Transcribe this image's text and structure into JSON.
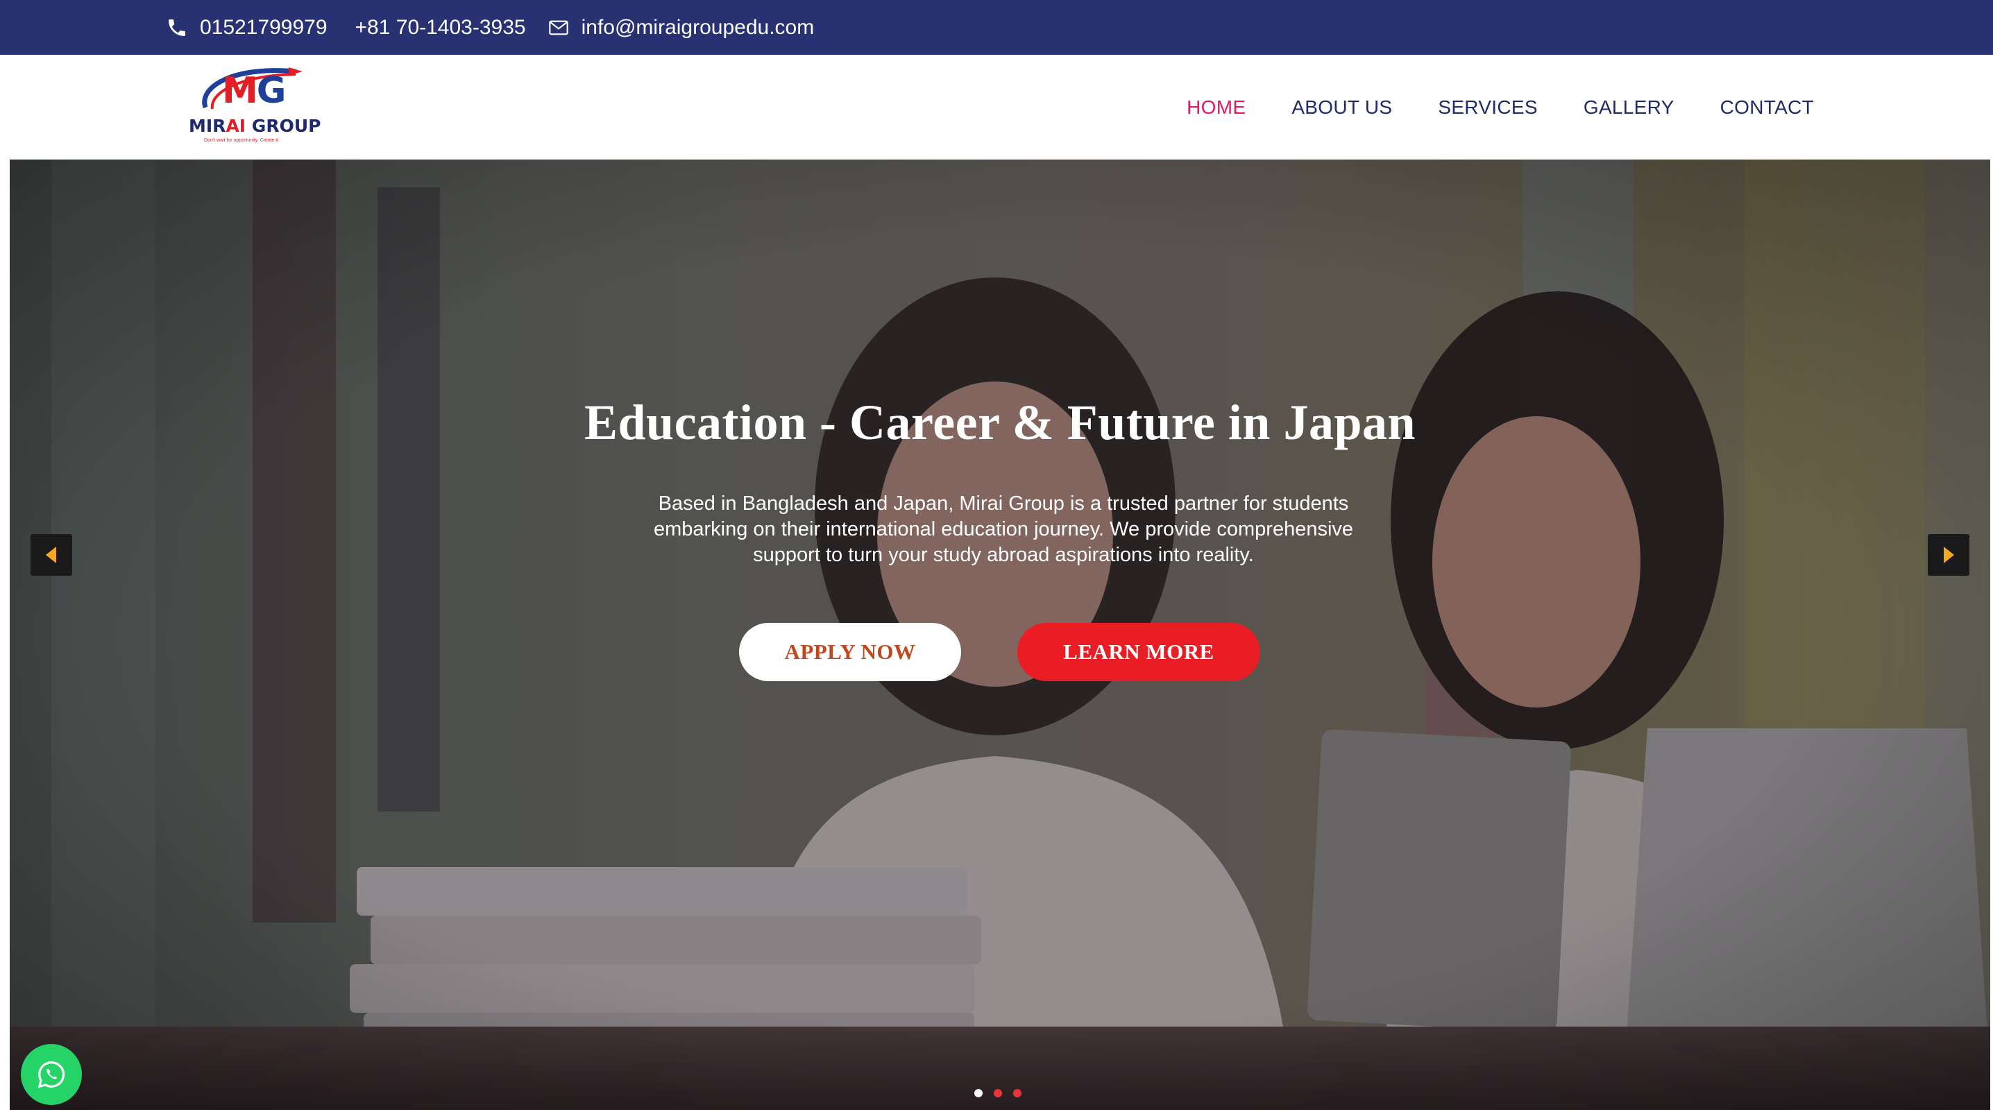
{
  "topbar": {
    "phone1": "01521799979",
    "phone2": "+81 70-1403-3935",
    "email": "info@miraigroupedu.com",
    "phone_icon": "phone-icon",
    "mail_icon": "envelope-icon"
  },
  "logo": {
    "mark_m": "M",
    "mark_g": "G",
    "brand_a": "MIR",
    "brand_ai": "AI",
    "brand_b": " GROUP",
    "tagline": "Don't wait for opportunity. Create it."
  },
  "nav": {
    "items": [
      {
        "label": "HOME",
        "active": true
      },
      {
        "label": "ABOUT US",
        "active": false
      },
      {
        "label": "SERVICES",
        "active": false
      },
      {
        "label": "GALLERY",
        "active": false
      },
      {
        "label": "CONTACT",
        "active": false
      }
    ]
  },
  "hero": {
    "title": "Education - Career & Future in Japan",
    "description": "Based in Bangladesh and Japan, Mirai Group is a trusted partner for students embarking on their international education journey. We provide comprehensive support to turn your study abroad aspirations into reality.",
    "apply_label": "APPLY NOW",
    "learn_label": "LEARN MORE",
    "prev_icon": "caret-left-icon",
    "next_icon": "caret-right-icon",
    "slides": 3,
    "active_slide": 1
  },
  "colors": {
    "topbar_bg": "#283171",
    "nav_text": "#1f2a6b",
    "nav_active": "#e8185c",
    "apply_text": "#c0481d",
    "learn_bg": "#ea1c24",
    "arrow_accent": "#f5a623",
    "whatsapp": "#25d366"
  },
  "whatsapp": {
    "icon": "whatsapp-icon"
  }
}
